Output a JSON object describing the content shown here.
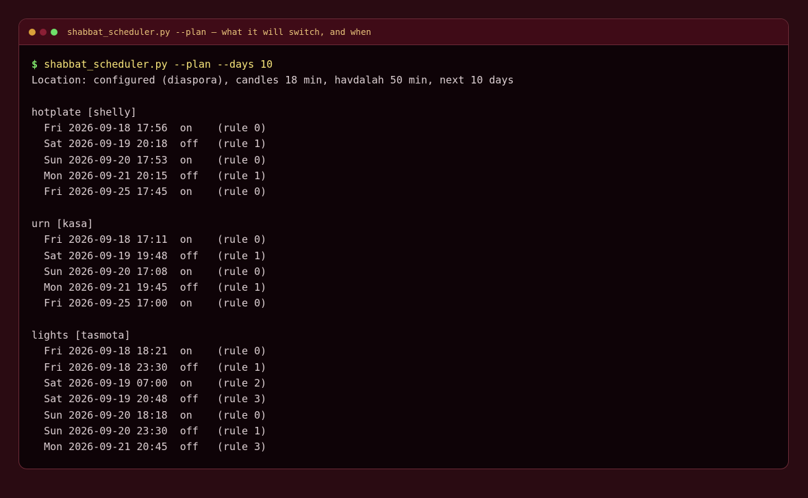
{
  "window": {
    "title": "shabbat_scheduler.py --plan — what it will switch, and when",
    "traffic_lights": {
      "close_color": "#d9a13a",
      "min_color": "#8a1f35",
      "max_color": "#6fe06a"
    }
  },
  "terminal": {
    "prompt_symbol": "$",
    "command": "shabbat_scheduler.py --plan --days 10",
    "location_line": "Location: configured (diaspora), candles 18 min, havdalah 50 min, next 10 days",
    "devices": [
      {
        "header": "hotplate [shelly]",
        "entries": [
          "Fri 2026-09-18 17:56  on    (rule 0)",
          "Sat 2026-09-19 20:18  off   (rule 1)",
          "Sun 2026-09-20 17:53  on    (rule 0)",
          "Mon 2026-09-21 20:15  off   (rule 1)",
          "Fri 2026-09-25 17:45  on    (rule 0)"
        ]
      },
      {
        "header": "urn [kasa]",
        "entries": [
          "Fri 2026-09-18 17:11  on    (rule 0)",
          "Sat 2026-09-19 19:48  off   (rule 1)",
          "Sun 2026-09-20 17:08  on    (rule 0)",
          "Mon 2026-09-21 19:45  off   (rule 1)",
          "Fri 2026-09-25 17:00  on    (rule 0)"
        ]
      },
      {
        "header": "lights [tasmota]",
        "entries": [
          "Fri 2026-09-18 18:21  on    (rule 0)",
          "Fri 2026-09-18 23:30  off   (rule 1)",
          "Sat 2026-09-19 07:00  on    (rule 2)",
          "Sat 2026-09-19 20:48  off   (rule 3)",
          "Sun 2026-09-20 18:18  on    (rule 0)",
          "Sun 2026-09-20 23:30  off   (rule 1)",
          "Mon 2026-09-21 20:45  off   (rule 3)"
        ]
      }
    ]
  }
}
